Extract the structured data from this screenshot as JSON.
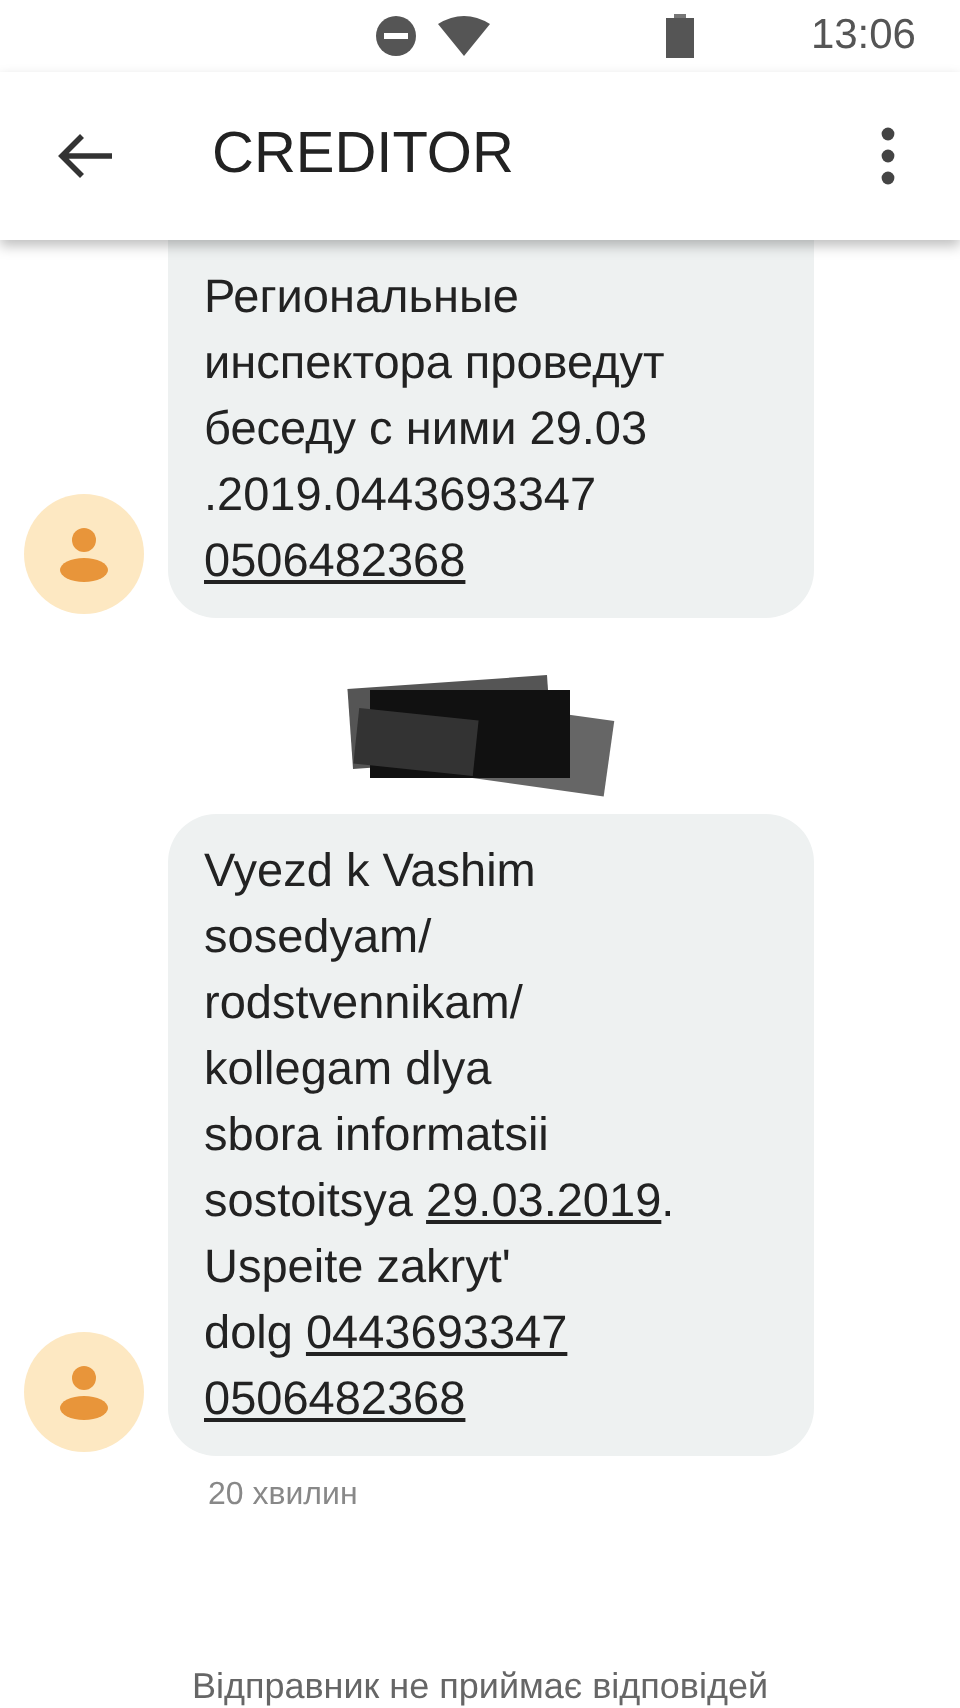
{
  "status_bar": {
    "time": "13:06"
  },
  "app_bar": {
    "title": "CREDITOR"
  },
  "messages": [
    {
      "lines": [
        [
          {
            "kind": "text",
            "text": "Региональные"
          }
        ],
        [
          {
            "kind": "text",
            "text": "инспектора проведут"
          }
        ],
        [
          {
            "kind": "text",
            "text": "беседу с ними 29.03"
          }
        ],
        [
          {
            "kind": "text",
            "text": ".2019.0443693347"
          }
        ],
        [
          {
            "kind": "link",
            "text": "0506482368"
          }
        ]
      ]
    },
    {
      "lines": [
        [
          {
            "kind": "text",
            "text": "Vyezd k Vashim"
          }
        ],
        [
          {
            "kind": "text",
            "text": "sosedyam/"
          }
        ],
        [
          {
            "kind": "text",
            "text": "rodstvennikam/"
          }
        ],
        [
          {
            "kind": "text",
            "text": "kollegam dlya"
          }
        ],
        [
          {
            "kind": "text",
            "text": "sbora informatsii"
          }
        ],
        [
          {
            "kind": "text",
            "text": "sostoitsya "
          },
          {
            "kind": "link",
            "text": "29.03.2019"
          },
          {
            "kind": "text",
            "text": "."
          }
        ],
        [
          {
            "kind": "text",
            "text": "Uspeite zakryt'"
          }
        ],
        [
          {
            "kind": "text",
            "text": "dolg "
          },
          {
            "kind": "link",
            "text": "0443693347"
          }
        ],
        [
          {
            "kind": "link",
            "text": "0506482368"
          }
        ]
      ],
      "timestamp": "20 хвилин"
    }
  ],
  "footer": "Відправник не приймає відповідей"
}
